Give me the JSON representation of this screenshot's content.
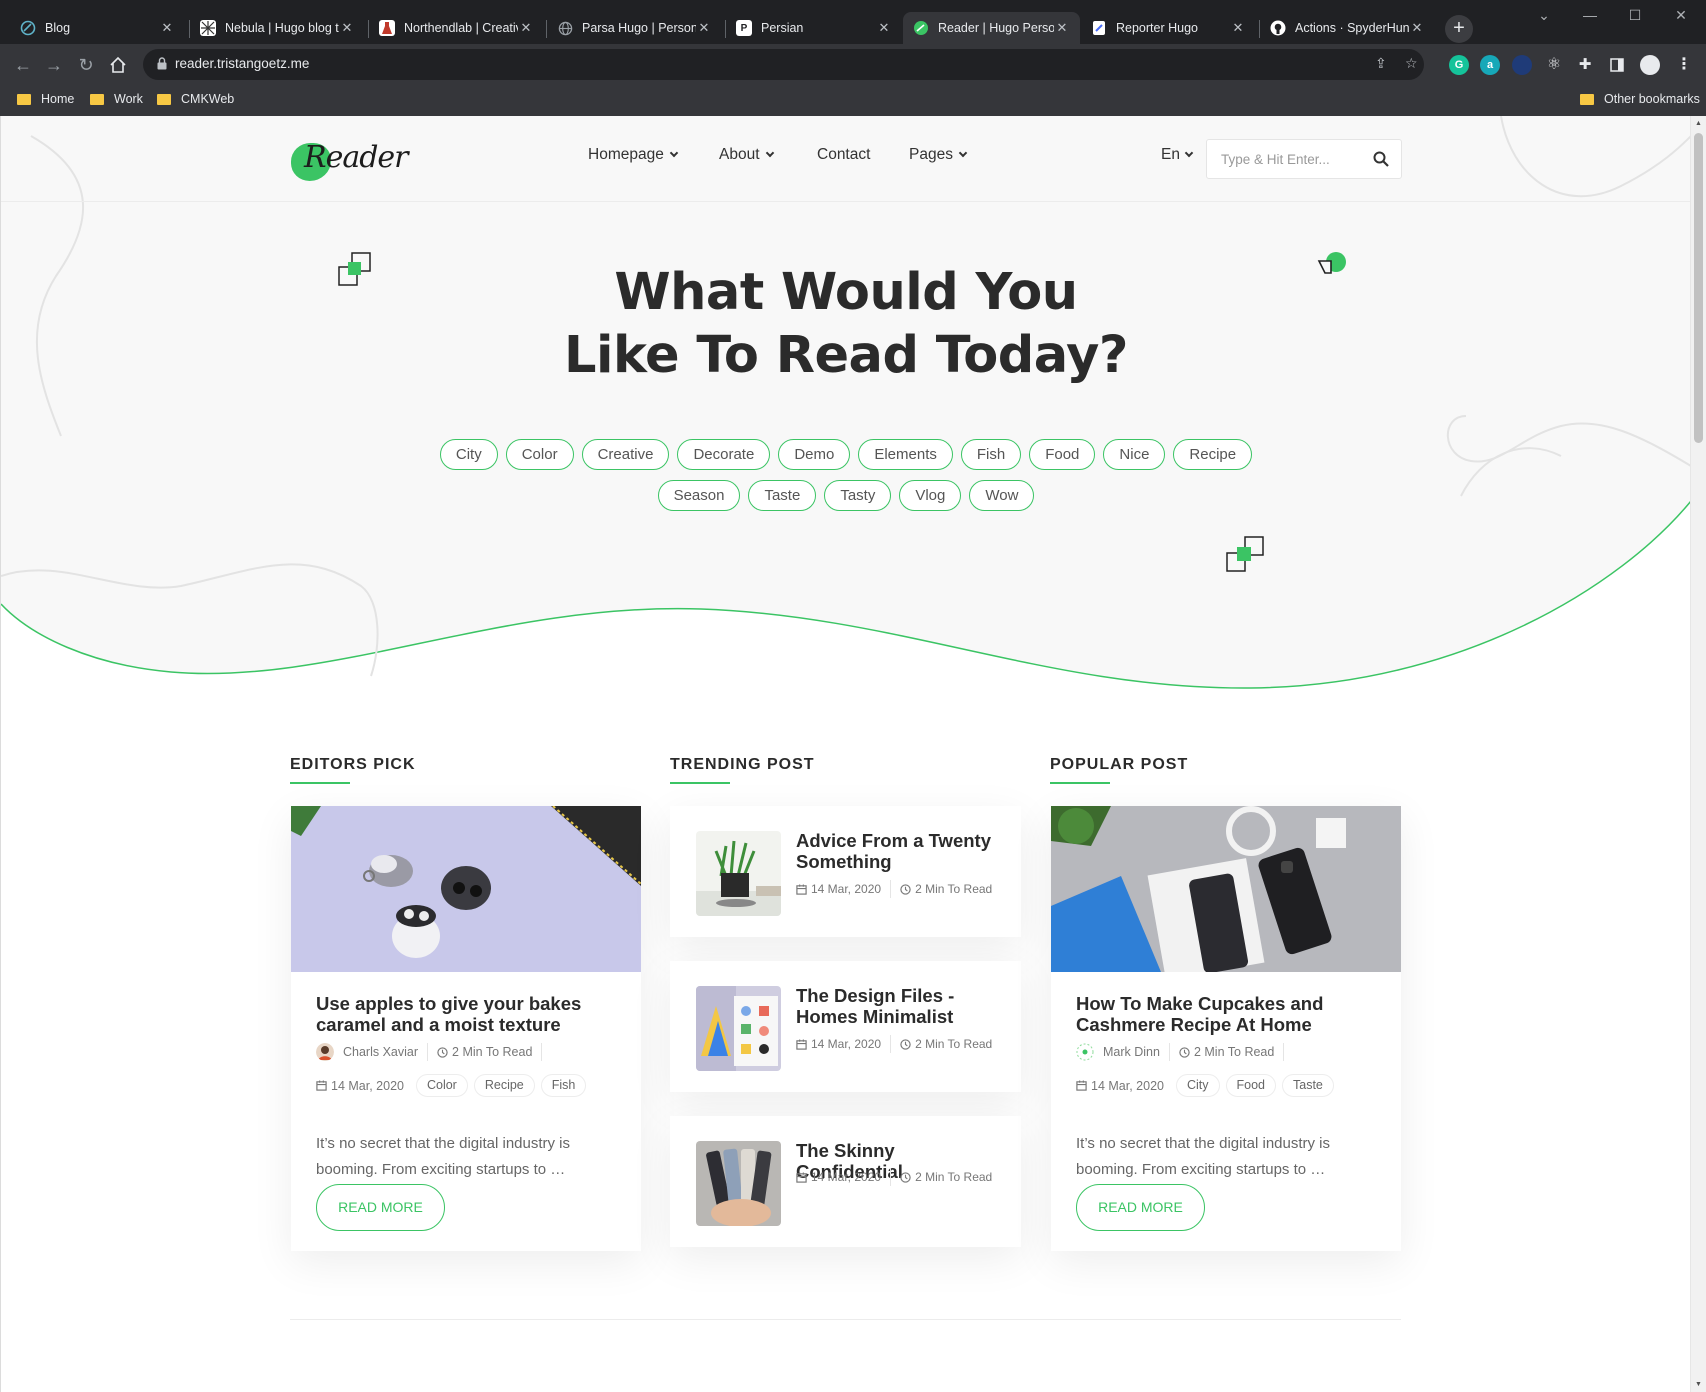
{
  "browser": {
    "tabs": [
      {
        "title": "Blog",
        "icon_color": "#5fb3c9"
      },
      {
        "title": "Nebula | Hugo blog t",
        "icon_color": "#ffffff"
      },
      {
        "title": "Northendlab | Creativ",
        "icon_color": "#c0392b"
      },
      {
        "title": "Parsa Hugo | Persona",
        "icon_color": "#9aa0a6"
      },
      {
        "title": "Persian",
        "icon_color": "#ffffff"
      },
      {
        "title": "Reader | Hugo Person",
        "icon_color": "#3bc464",
        "active": true
      },
      {
        "title": "Reporter Hugo",
        "icon_color": "#4a6cf7"
      },
      {
        "title": "Actions · SpyderHunt",
        "icon_color": "#ffffff"
      }
    ],
    "url": "reader.tristangoetz.me",
    "bookmarks": [
      "Home",
      "Work",
      "CMKWeb"
    ],
    "other_bookmarks": "Other bookmarks"
  },
  "site": {
    "logo_text": "Reader",
    "nav": [
      {
        "label": "Homepage",
        "dropdown": true
      },
      {
        "label": "About",
        "dropdown": true
      },
      {
        "label": "Contact",
        "dropdown": false
      },
      {
        "label": "Pages",
        "dropdown": true
      }
    ],
    "language": "En",
    "search_placeholder": "Type & Hit Enter...",
    "accent_color": "#3bc464"
  },
  "hero": {
    "headline_line1": "What Would You",
    "headline_line2": "Like To Read Today?",
    "tags": [
      "City",
      "Color",
      "Creative",
      "Decorate",
      "Demo",
      "Elements",
      "Fish",
      "Food",
      "Nice",
      "Recipe",
      "Season",
      "Taste",
      "Tasty",
      "Vlog",
      "Wow"
    ]
  },
  "sections": {
    "editors_pick": {
      "heading": "EDITORS PICK",
      "post": {
        "title": "Use apples to give your bakes caramel and a moist texture",
        "author": "Charls Xaviar",
        "read_time": "2 Min To Read",
        "date": "14 Mar, 2020",
        "tags": [
          "Color",
          "Recipe",
          "Fish"
        ],
        "excerpt": "It’s no secret that the digital industry is booming. From exciting startups to …",
        "button": "READ MORE"
      }
    },
    "trending": {
      "heading": "TRENDING POST",
      "posts": [
        {
          "title": "Advice From a Twenty Something",
          "date": "14 Mar, 2020",
          "read_time": "2 Min To Read"
        },
        {
          "title": "The Design Files - Homes Minimalist",
          "date": "14 Mar, 2020",
          "read_time": "2 Min To Read"
        },
        {
          "title": "The Skinny Confidential",
          "date": "14 Mar, 2020",
          "read_time": "2 Min To Read"
        }
      ]
    },
    "popular": {
      "heading": "POPULAR POST",
      "post": {
        "title": "How To Make Cupcakes and Cashmere Recipe At Home",
        "author": "Mark Dinn",
        "read_time": "2 Min To Read",
        "date": "14 Mar, 2020",
        "tags": [
          "City",
          "Food",
          "Taste"
        ],
        "excerpt": "It’s no secret that the digital industry is booming. From exciting startups to …",
        "button": "READ MORE"
      }
    }
  }
}
